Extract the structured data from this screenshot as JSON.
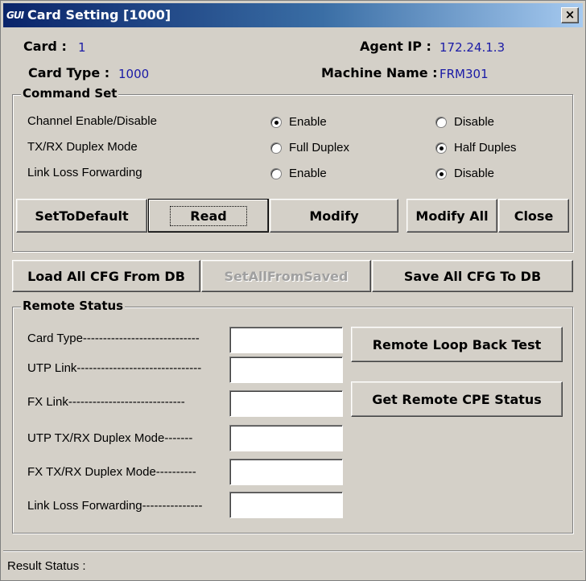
{
  "window": {
    "title": "Card Setting [1000]",
    "icon_text": "GUI",
    "close_label": "×"
  },
  "info": {
    "card_label": "Card :",
    "card_value": "1",
    "card_type_label": "Card Type :",
    "card_type_value": "1000",
    "agent_ip_label": "Agent IP :",
    "agent_ip_value": "172.24.1.3",
    "machine_name_label": "Machine Name :",
    "machine_name_value": "FRM301"
  },
  "command_set": {
    "title": "Command  Set",
    "rows": [
      {
        "label": "Channel Enable/Disable",
        "option_a": "Enable",
        "option_b": "Disable",
        "selected": "a"
      },
      {
        "label": "TX/RX Duplex Mode",
        "option_a": "Full Duplex",
        "option_b": "Half Duples",
        "selected": "b"
      },
      {
        "label": "Link Loss Forwarding",
        "option_a": "Enable",
        "option_b": "Disable",
        "selected": "b"
      }
    ],
    "buttons": {
      "set_to_default": "SetToDefault",
      "read": "Read",
      "modify": "Modify",
      "modify_all": "Modify All",
      "close": "Close"
    }
  },
  "db_buttons": {
    "load_all": "Load All CFG From DB",
    "set_all_from_saved": "SetAllFromSaved",
    "save_all": "Save All CFG To DB"
  },
  "remote_status": {
    "title": "Remote Status",
    "fields": [
      {
        "label": "Card Type-----------------------------",
        "value": ""
      },
      {
        "label": "UTP Link-------------------------------",
        "value": ""
      },
      {
        "label": "FX    Link-----------------------------",
        "value": ""
      },
      {
        "label": "UTP TX/RX Duplex Mode-------",
        "value": ""
      },
      {
        "label": "FX TX/RX Duplex Mode----------",
        "value": ""
      },
      {
        "label": "Link Loss Forwarding---------------",
        "value": ""
      }
    ],
    "loop_back_button": "Remote Loop Back Test",
    "get_cpe_button": "Get Remote CPE Status"
  },
  "status_bar": {
    "text": "Result Status :"
  }
}
